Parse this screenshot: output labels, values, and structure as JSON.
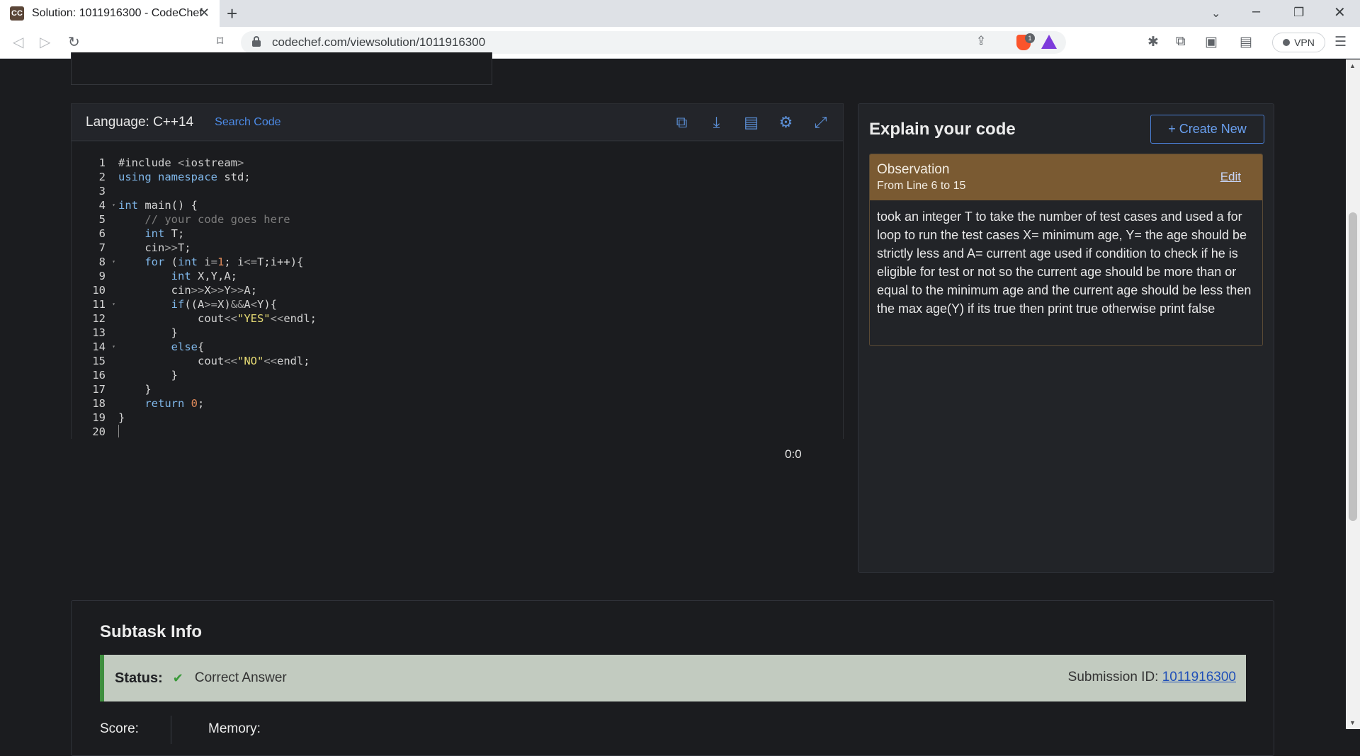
{
  "browser": {
    "tab_title": "Solution: 1011916300 - CodeChef",
    "favicon_text": "CC",
    "url": "codechef.com/viewsolution/1011916300",
    "shields_count": "1",
    "vpn_label": "VPN"
  },
  "code_panel": {
    "language_label": "Language: C++14",
    "search_code_label": "Search Code",
    "icons": [
      "copy-icon",
      "download-icon",
      "file-icon",
      "settings-icon",
      "expand-icon"
    ],
    "lines": [
      "#include <iostream>",
      "using namespace std;",
      "",
      "int main() {",
      "    // your code goes here",
      "    int T;",
      "    cin>>T;",
      "    for (int i=1; i<=T;i++){",
      "        int X,Y,A;",
      "        cin>>X>>Y>>A;",
      "        if((A>=X)&&A<Y){",
      "            cout<<\"YES\"<<endl;",
      "        }",
      "        else{",
      "            cout<<\"NO\"<<endl;",
      "        }",
      "    }",
      "    return 0;",
      "}",
      ""
    ],
    "line_numbers": [
      "1",
      "2",
      "3",
      "4",
      "5",
      "6",
      "7",
      "8",
      "9",
      "10",
      "11",
      "12",
      "13",
      "14",
      "15",
      "16",
      "17",
      "18",
      "19",
      "20"
    ],
    "cursor_position": "0:0"
  },
  "explain": {
    "title": "Explain your code",
    "create_button": "+ Create New",
    "observation": {
      "title": "Observation",
      "range": "From Line 6 to 15",
      "edit_label": "Edit",
      "body": "took an integer T to take the number of test cases and used a for loop to run the test cases X= minimum age, Y= the age should be strictly less and A= current age used if condition to check if he is eligible for test or not so the current age should be more than or equal to the minimum age and the current age should be less then the max age(Y) if its true then print true otherwise print false"
    }
  },
  "subtask": {
    "title": "Subtask Info",
    "status_label": "Status:",
    "status_value": "Correct Answer",
    "submission_label": "Submission ID:",
    "submission_id": "1011916300",
    "score_label": "Score:",
    "memory_label": "Memory:"
  },
  "colors": {
    "page_bg": "#1b1c1f",
    "accent_blue": "#4c8be8",
    "observation_header": "#7a5a32",
    "status_bg": "#c2cbc0",
    "status_border": "#3e8e3e"
  }
}
